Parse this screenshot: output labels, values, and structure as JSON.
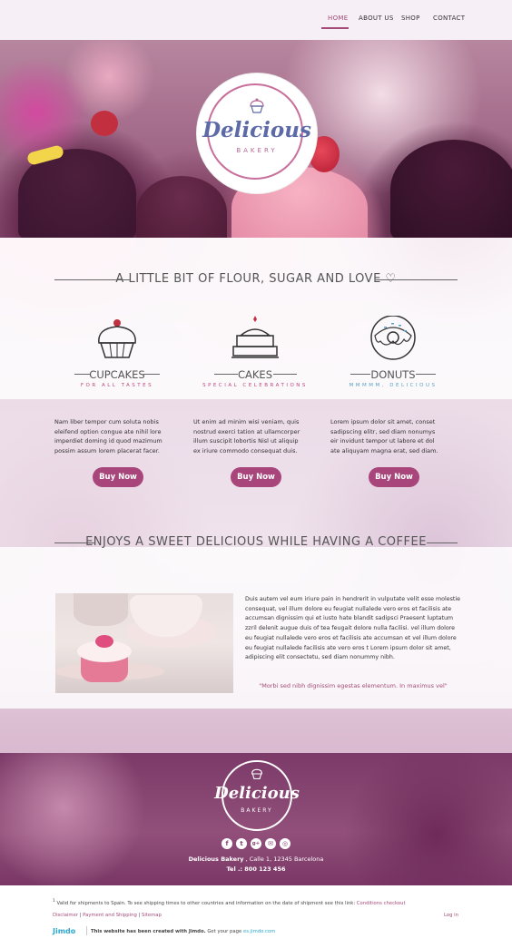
{
  "nav": {
    "items": [
      "HOME",
      "ABOUT US",
      "SHOP",
      "CONTACT"
    ],
    "active": "HOME"
  },
  "logo": {
    "title": "Delicious",
    "subtitle": "BAKERY"
  },
  "section1": {
    "title": "A LITTLE BIT OF FLOUR, SUGAR AND LOVE ♡",
    "features": [
      {
        "name": "CUPCAKES",
        "tagline": "FOR ALL TASTES",
        "tagline_color": "#c0477b",
        "icon": "cupcake-icon",
        "text": "Nam liber tempor cum soluta nobis eleifend option congue ate nihil lore imperdiet doming id quod mazimum possim assum lorem placerat facer.",
        "button": "Buy Now"
      },
      {
        "name": "CAKES",
        "tagline": "SPECIAL CELEBRATIONS",
        "tagline_color": "#c0477b",
        "icon": "cake-icon",
        "text": "Ut enim ad minim wisi veniam, quis nostrud exerci tation at ullamcorper illum suscipit lobortis Nisl ut aliquip ex iriure commodo consequat duis.",
        "button": "Buy Now"
      },
      {
        "name": "DONUTS",
        "tagline": "MMMMM, DELICIOUS",
        "tagline_color": "#5aa0c8",
        "icon": "donut-icon",
        "text": "Lorem ipsum dolor sit amet, conset sadipscing elitr, sed diam nonumys eir invidunt tempor ut labore et dol ate aliquyam magna erat, sed diam.",
        "button": "Buy Now"
      }
    ]
  },
  "section2": {
    "title": "ENJOYS A SWEET DELICIOUS WHILE HAVING A COFFEE",
    "paragraph": "Duis autem vel eum iriure pain in hendrerit in vulputate velit esse molestie consequat, vel illum dolore eu feugiat nullalede vero eros et facilisis ate accumsan dignissim qui et iusto hate blandit sadipsci Praesent luptatum zzril delenit augue duis of tea feugait dolore nulla facilisi.  vel illum dolore eu feugiat nullalede vero eros et facilisis ate accumsan et  vel illum dolore eu feugiat nullalede facilisis ate vero eros t Lorem ipsum dolor sit amet, adipiscing elit consectetu, sed diam nonummy nibh.",
    "quote": "\"Morbi sed nibh dignissim egestas elementum. In maximus vel\""
  },
  "footer": {
    "logo_title": "Delicious",
    "logo_subtitle": "BAKERY",
    "social": [
      "f",
      "t",
      "g+",
      "✉",
      "◎"
    ],
    "address_name": "Delicious Bakery",
    "address_rest": " , Calle 1, 12345 Barcelona",
    "tel": "Tel .: 800 123 456"
  },
  "bottom": {
    "footnote_mark": "1",
    "footnote": " Valid for shipments to Spain. To see shipping times to other countries and information on the date of shipment see this link: ",
    "footnote_link": "Conditions checkout",
    "links": [
      "Disclaimer",
      "Payment and Shipping",
      "Sitemap"
    ],
    "login": "Log in",
    "jimdo": "Jimdo",
    "created": "This website has been created with Jimdo.",
    "get_page": " Get your page ",
    "get_page_link": "es.jimdo.com"
  },
  "colors": {
    "accent": "#a8457a",
    "footer": "#7b3a68"
  }
}
